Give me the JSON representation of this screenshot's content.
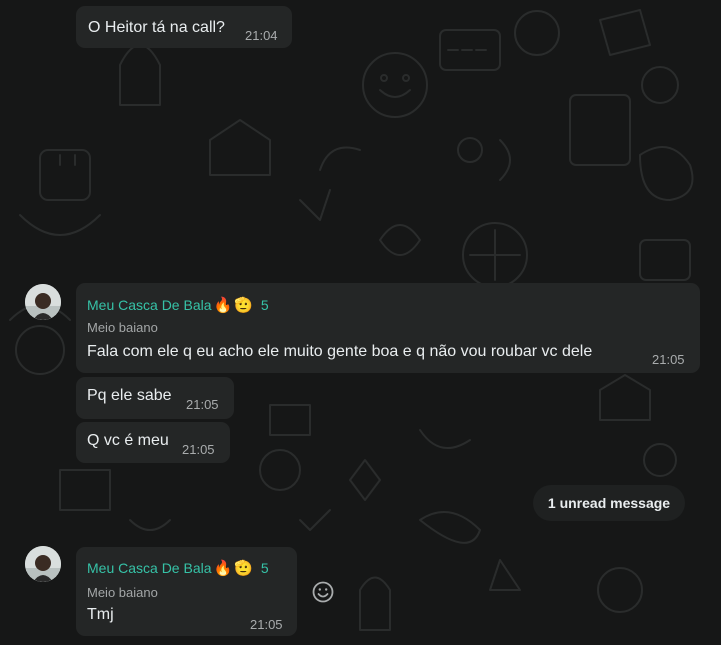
{
  "messages_top": {
    "text": "O Heitor tá na call?",
    "time": "21:04"
  },
  "group1": {
    "sender_name": "Meu Casca De Bala",
    "sender_emoji_1": "🔥",
    "sender_emoji_2": "🫡",
    "sender_count": "5",
    "subtitle": "Meio baiano",
    "msg1_text": "Fala com ele q eu acho ele muito gente boa e q não vou roubar vc dele",
    "msg1_time": "21:05",
    "msg2_text": "Pq ele sabe",
    "msg2_time": "21:05",
    "msg3_text": "Q vc é meu",
    "msg3_time": "21:05"
  },
  "unread_label": "1 unread message",
  "group2": {
    "sender_name": "Meu Casca De Bala",
    "sender_emoji_1": "🔥",
    "sender_emoji_2": "🫡",
    "sender_count": "5",
    "subtitle": "Meio baiano",
    "msg_text": "Tmj",
    "msg_time": "21:05"
  },
  "icons": {
    "react": "emoji-smile-icon",
    "avatar": "user-avatar"
  },
  "colors": {
    "background": "#161717",
    "bubble": "#242626",
    "sender": "#36c2a7",
    "time": "#a9acad"
  }
}
